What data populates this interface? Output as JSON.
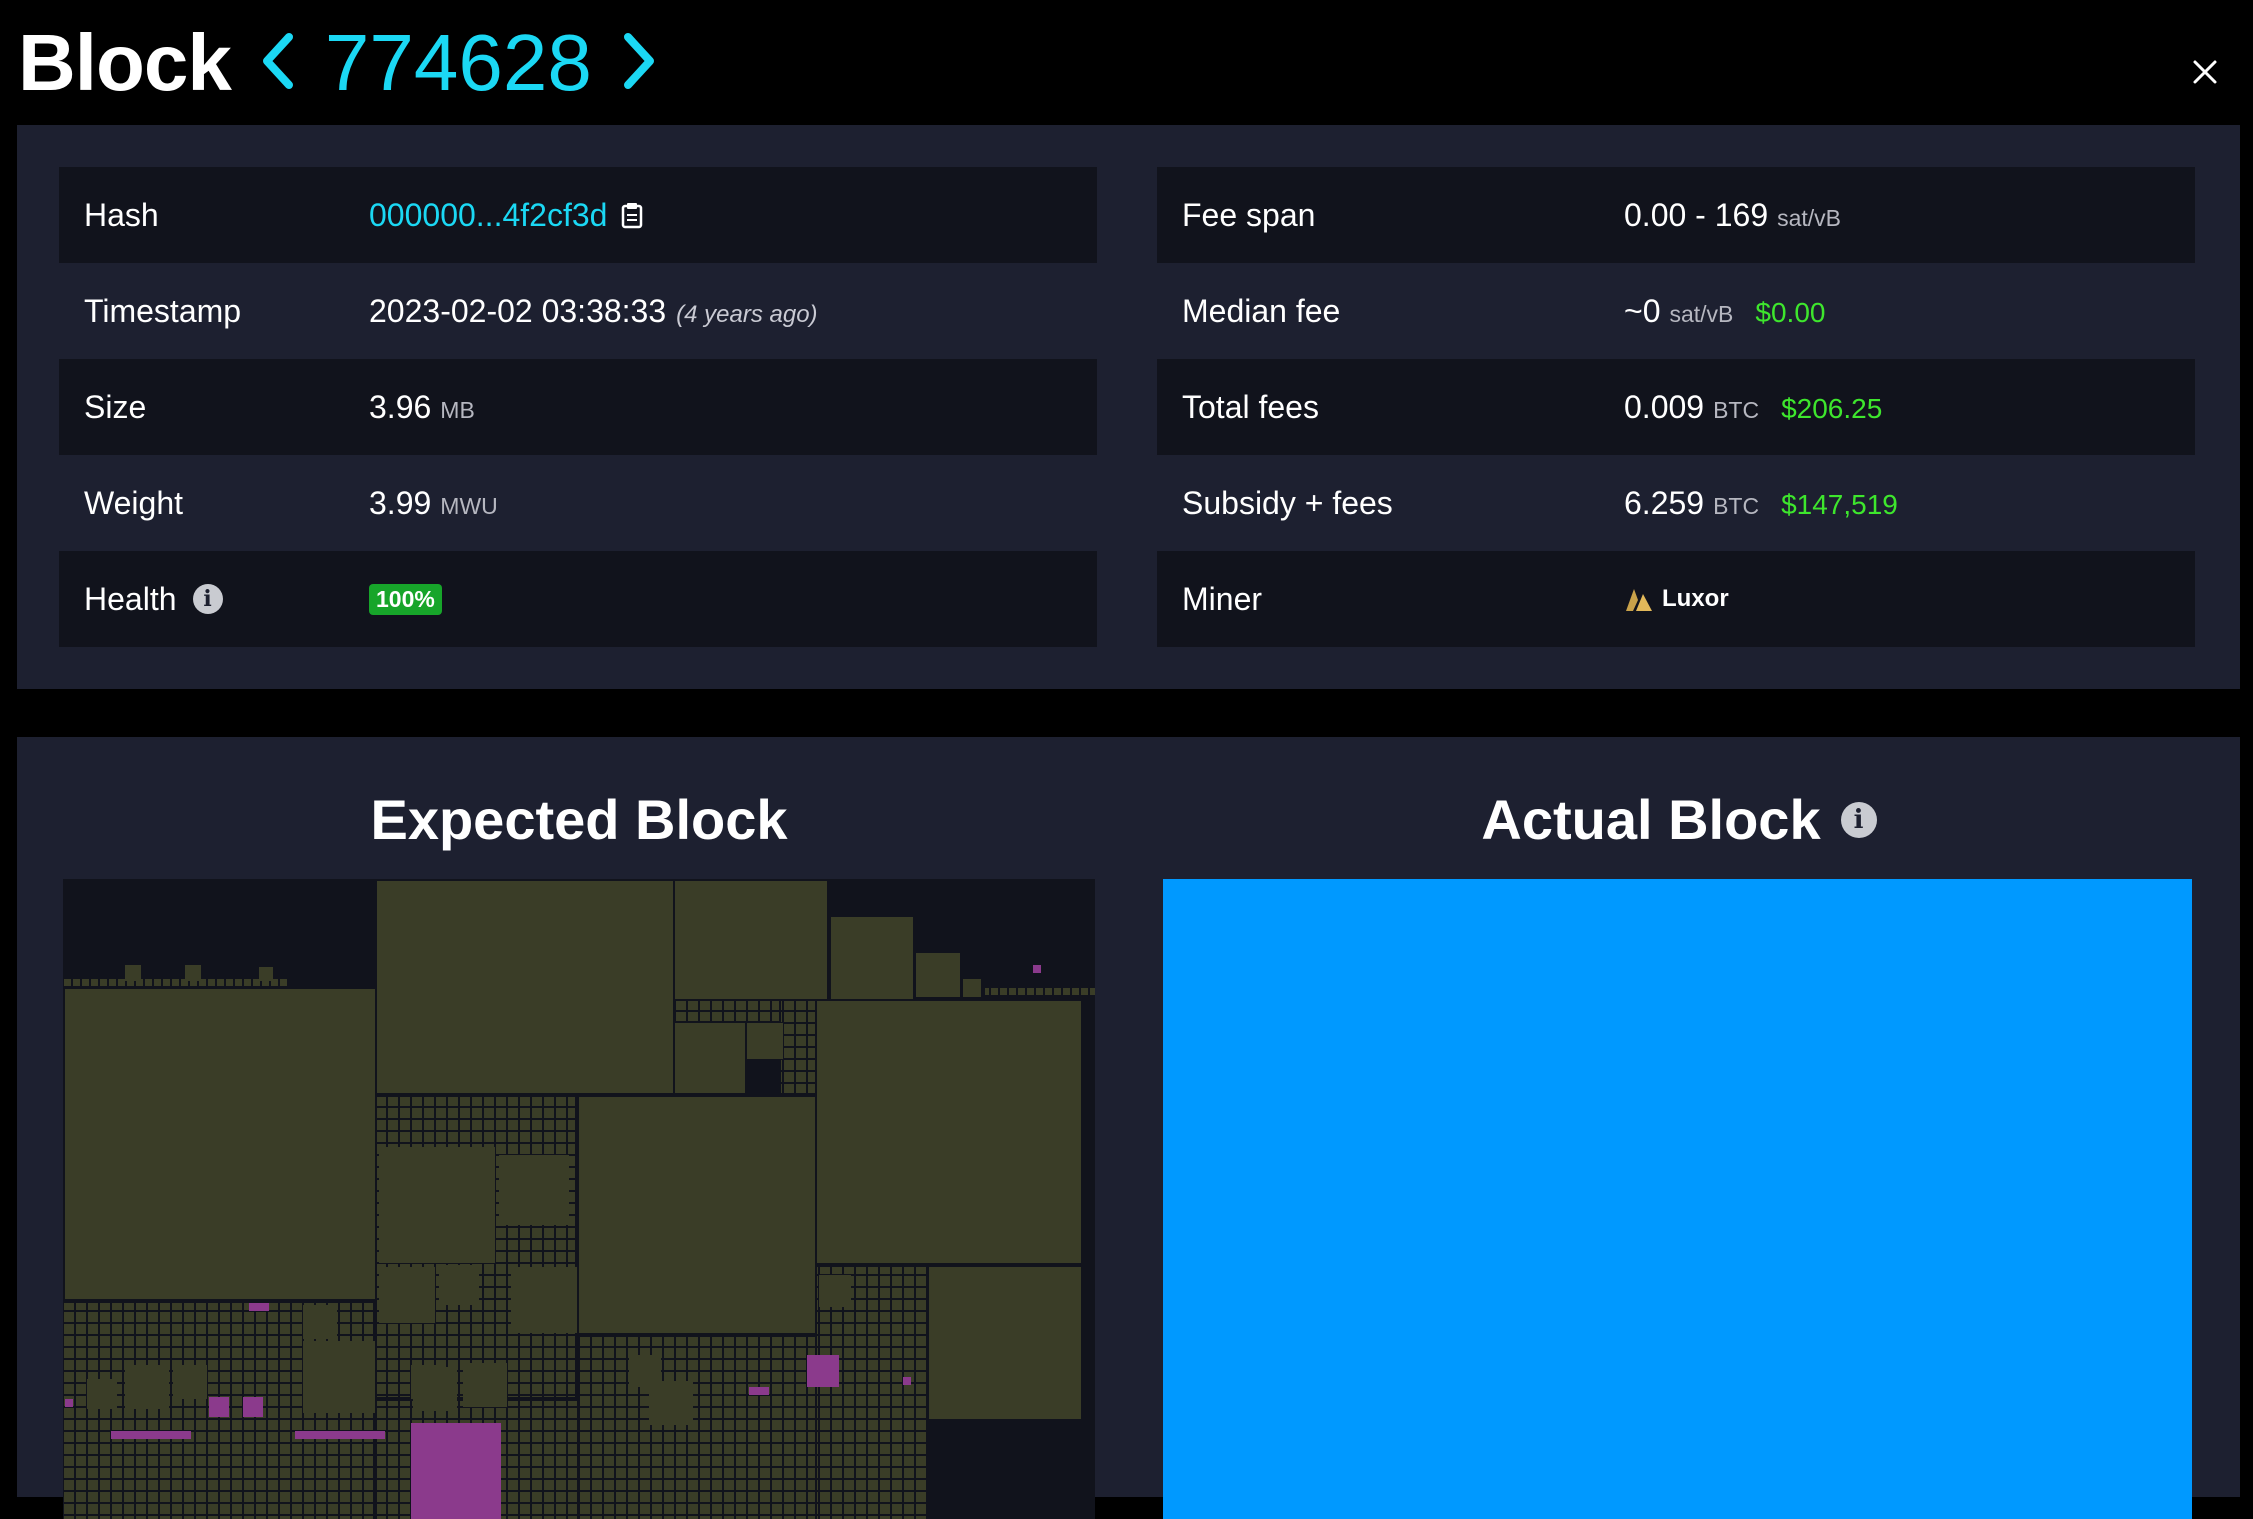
{
  "header": {
    "title": "Block",
    "block_number": "774628"
  },
  "details": {
    "left": [
      {
        "label": "Hash",
        "value": "000000...4f2cf3d"
      },
      {
        "label": "Timestamp",
        "value": "2023-02-02 03:38:33",
        "relative": "(4 years ago)"
      },
      {
        "label": "Size",
        "value": "3.96",
        "unit": "MB"
      },
      {
        "label": "Weight",
        "value": "3.99",
        "unit": "MWU"
      },
      {
        "label": "Health",
        "value": "100%"
      }
    ],
    "right": [
      {
        "label": "Fee span",
        "value": "0.00 - 169",
        "unit": "sat/vB"
      },
      {
        "label": "Median fee",
        "value": "~0",
        "unit": "sat/vB",
        "fiat": "$0.00"
      },
      {
        "label": "Total fees",
        "value": "0.009",
        "unit": "BTC",
        "fiat": "$206.25"
      },
      {
        "label": "Subsidy + fees",
        "value": "6.259",
        "unit": "BTC",
        "fiat": "$147,519"
      },
      {
        "label": "Miner",
        "value": "Luxor"
      }
    ]
  },
  "viz": {
    "expected_title": "Expected Block",
    "actual_title": "Actual Block"
  },
  "colors": {
    "accent": "#1bd8f4",
    "fiat": "#3ee62d",
    "health": "#17a52a",
    "tx_default": "#3a3d27",
    "tx_highlight": "#8b3a8c",
    "actual_fill": "#0099ff"
  }
}
